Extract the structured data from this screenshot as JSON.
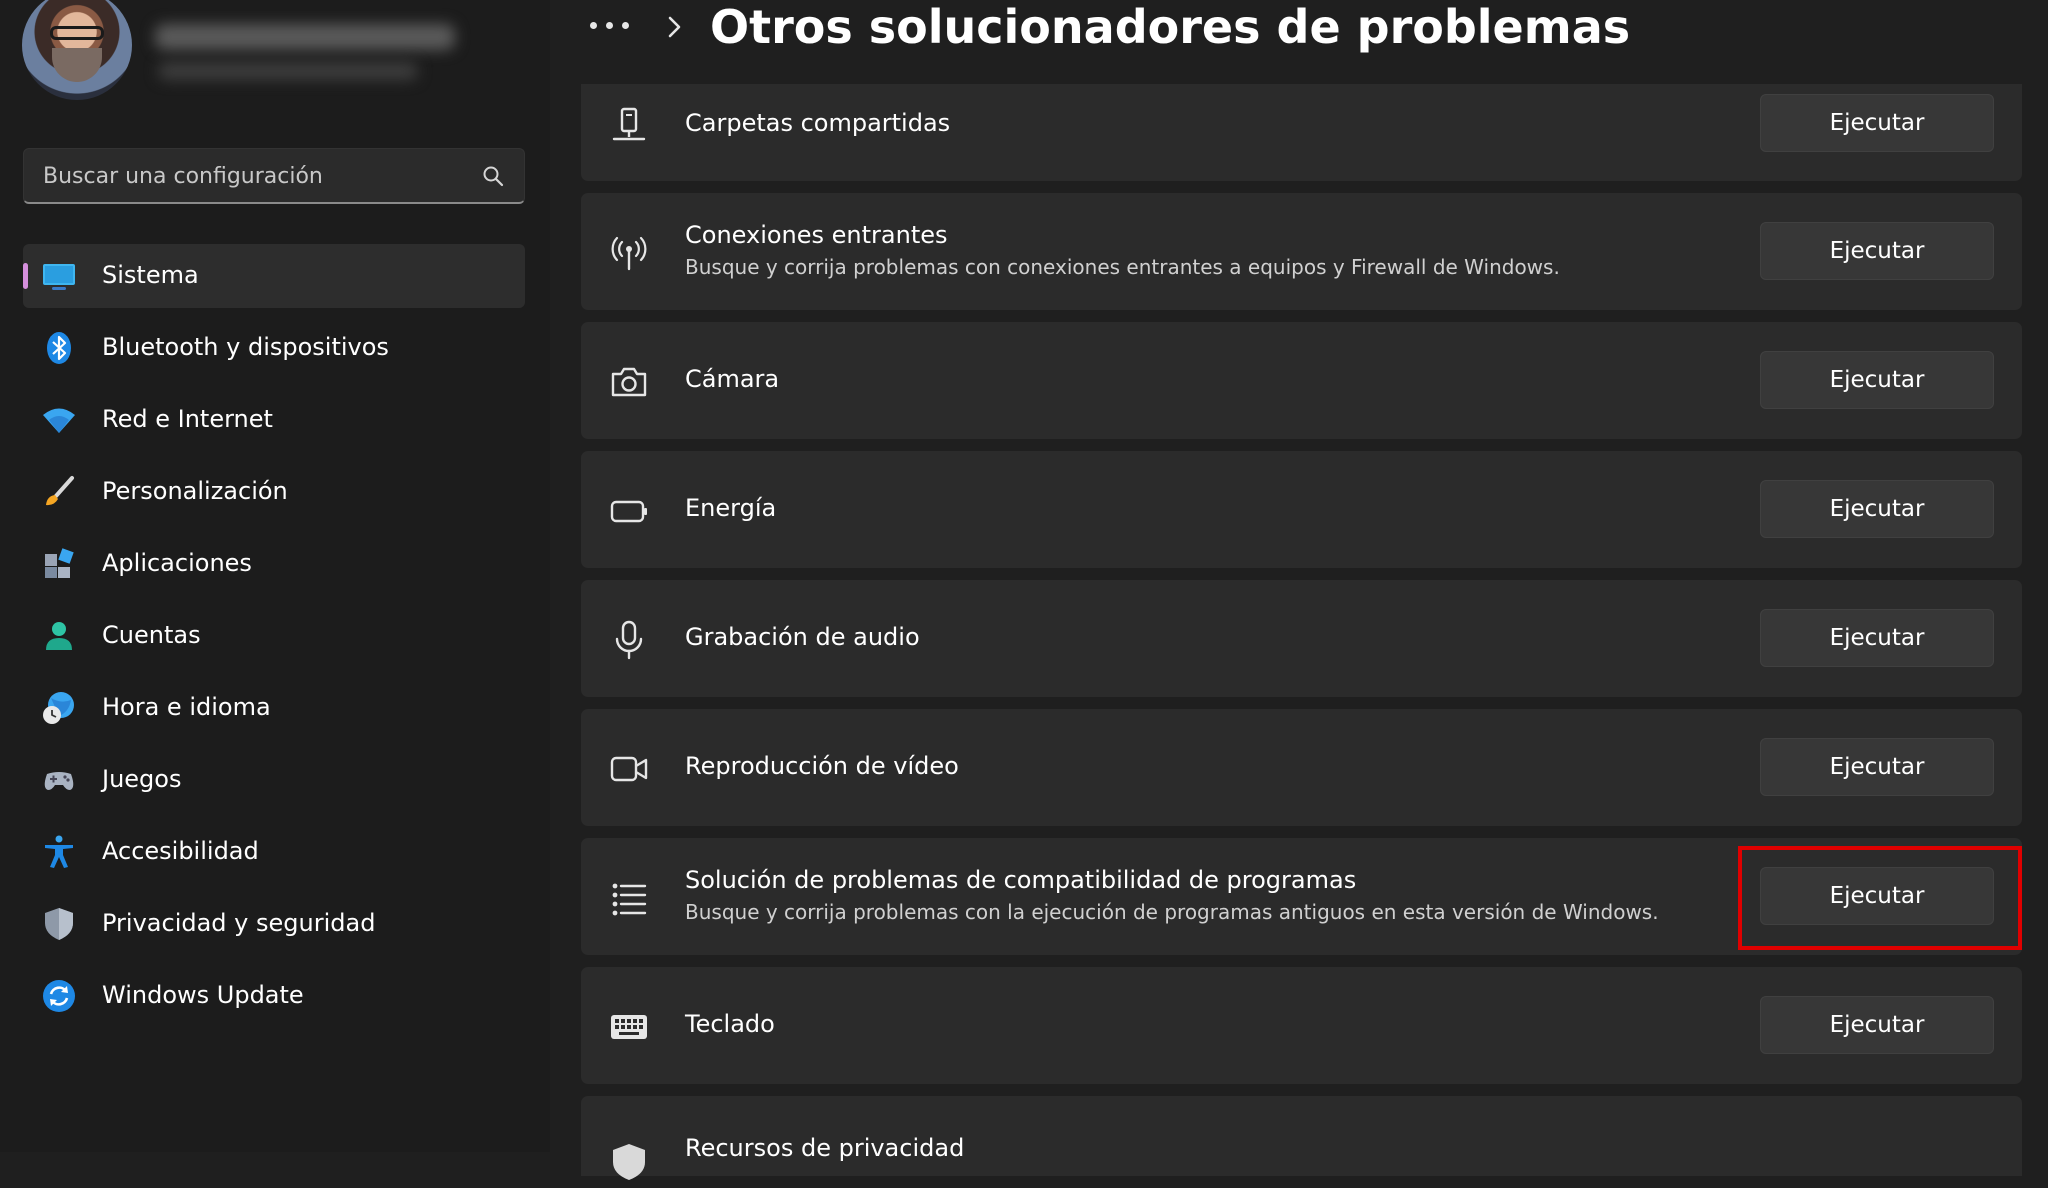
{
  "header": {
    "title": "Otros solucionadores de problemas"
  },
  "search": {
    "placeholder": "Buscar una configuración"
  },
  "sidebar": {
    "items": [
      {
        "label": "Sistema",
        "icon": "monitor-icon",
        "active": true
      },
      {
        "label": "Bluetooth y dispositivos",
        "icon": "bluetooth-icon"
      },
      {
        "label": "Red e Internet",
        "icon": "wifi-icon"
      },
      {
        "label": "Personalización",
        "icon": "brush-icon"
      },
      {
        "label": "Aplicaciones",
        "icon": "apps-icon"
      },
      {
        "label": "Cuentas",
        "icon": "user-icon"
      },
      {
        "label": "Hora e idioma",
        "icon": "globe-clock-icon"
      },
      {
        "label": "Juegos",
        "icon": "gamepad-icon"
      },
      {
        "label": "Accesibilidad",
        "icon": "accessibility-icon"
      },
      {
        "label": "Privacidad y seguridad",
        "icon": "shield-icon"
      },
      {
        "label": "Windows Update",
        "icon": "refresh-icon"
      }
    ]
  },
  "troubleshooters": [
    {
      "title": "Carpetas compartidas",
      "description": "",
      "icon": "shared-folder-icon",
      "button": "Ejecutar"
    },
    {
      "title": "Conexiones entrantes",
      "description": "Busque y corrija problemas con conexiones entrantes a equipos y Firewall de Windows.",
      "icon": "antenna-icon",
      "button": "Ejecutar"
    },
    {
      "title": "Cámara",
      "description": "",
      "icon": "camera-icon",
      "button": "Ejecutar"
    },
    {
      "title": "Energía",
      "description": "",
      "icon": "battery-icon",
      "button": "Ejecutar"
    },
    {
      "title": "Grabación de audio",
      "description": "",
      "icon": "microphone-icon",
      "button": "Ejecutar"
    },
    {
      "title": "Reproducción de vídeo",
      "description": "",
      "icon": "video-camera-icon",
      "button": "Ejecutar"
    },
    {
      "title": "Solución de problemas de compatibilidad de programas",
      "description": "Busque y corrija problemas con la ejecución de programas antiguos en esta versión de Windows.",
      "icon": "list-icon",
      "button": "Ejecutar"
    },
    {
      "title": "Teclado",
      "description": "",
      "icon": "keyboard-icon",
      "button": "Ejecutar"
    },
    {
      "title": "Recursos de privacidad",
      "description": "",
      "icon": "shield-icon",
      "button": ""
    }
  ],
  "colors": {
    "accent": "#d58fdc",
    "highlight": "#e00000",
    "card": "#2b2b2b",
    "button": "#373737"
  }
}
